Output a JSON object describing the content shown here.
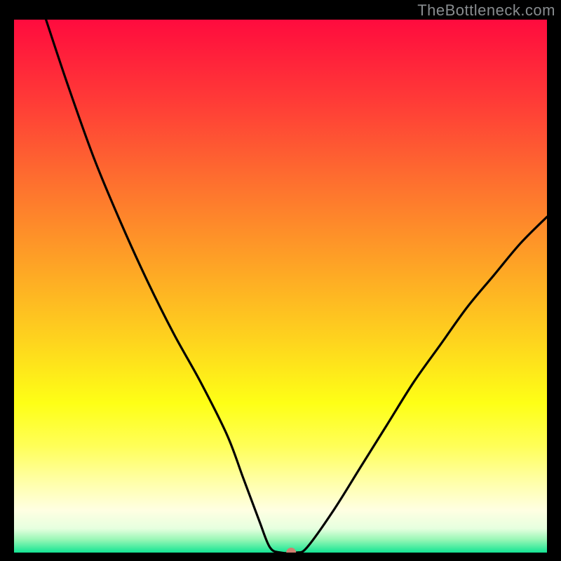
{
  "attribution": "TheBottleneck.com",
  "chart_data": {
    "type": "line",
    "title": "",
    "xlabel": "",
    "ylabel": "",
    "xlim": [
      0,
      100
    ],
    "ylim": [
      0,
      100
    ],
    "series": [
      {
        "name": "curve",
        "x": [
          6,
          10,
          15,
          20,
          25,
          30,
          35,
          40,
          43,
          46,
          48,
          50,
          53,
          55,
          60,
          65,
          70,
          75,
          80,
          85,
          90,
          95,
          100
        ],
        "y": [
          100,
          88,
          74,
          62,
          51,
          41,
          32,
          22,
          14,
          6,
          1,
          0,
          0,
          1,
          8,
          16,
          24,
          32,
          39,
          46,
          52,
          58,
          63
        ]
      }
    ],
    "marker": {
      "x": 52,
      "y": 0,
      "color": "#cf8071",
      "r": 7
    },
    "gradient_stops": [
      {
        "offset": 0.0,
        "color": "#ff0b3e"
      },
      {
        "offset": 0.15,
        "color": "#ff3a37"
      },
      {
        "offset": 0.3,
        "color": "#fe6e2f"
      },
      {
        "offset": 0.45,
        "color": "#fea026"
      },
      {
        "offset": 0.6,
        "color": "#fed31e"
      },
      {
        "offset": 0.72,
        "color": "#feff16"
      },
      {
        "offset": 0.8,
        "color": "#ffff58"
      },
      {
        "offset": 0.86,
        "color": "#ffffa0"
      },
      {
        "offset": 0.92,
        "color": "#ffffe2"
      },
      {
        "offset": 0.955,
        "color": "#e6ffdf"
      },
      {
        "offset": 0.975,
        "color": "#9bf7b7"
      },
      {
        "offset": 1.0,
        "color": "#14e593"
      }
    ]
  }
}
